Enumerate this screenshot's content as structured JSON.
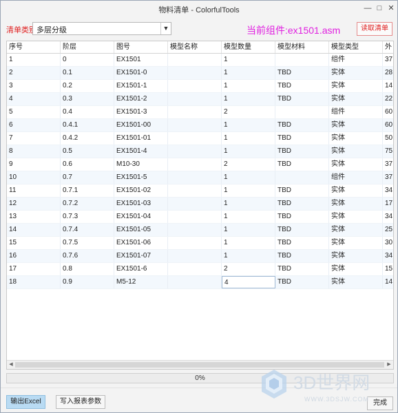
{
  "window": {
    "title": "物料清单 - ColorfulTools"
  },
  "toolbar": {
    "category_label": "清单类别",
    "category_value": "多层分级",
    "current_component": "当前组件:ex1501.asm",
    "read_button": "读取清单"
  },
  "table": {
    "columns": [
      "序号",
      "阶层",
      "图号",
      "模型名称",
      "模型数量",
      "模型材料",
      "模型类型",
      "外"
    ],
    "rows": [
      [
        "1",
        "0",
        "EX1501",
        "",
        "1",
        "",
        "组件",
        "37"
      ],
      [
        "2",
        "0.1",
        "EX1501-0",
        "",
        "1",
        "TBD",
        "实体",
        "28"
      ],
      [
        "3",
        "0.2",
        "EX1501-1",
        "",
        "1",
        "TBD",
        "实体",
        "14"
      ],
      [
        "4",
        "0.3",
        "EX1501-2",
        "",
        "1",
        "TBD",
        "实体",
        "22"
      ],
      [
        "5",
        "0.4",
        "EX1501-3",
        "",
        "2",
        "",
        "组件",
        "60"
      ],
      [
        "6",
        "0.4.1",
        "EX1501-00",
        "",
        "1",
        "TBD",
        "实体",
        "60"
      ],
      [
        "7",
        "0.4.2",
        "EX1501-01",
        "",
        "1",
        "TBD",
        "实体",
        "50"
      ],
      [
        "8",
        "0.5",
        "EX1501-4",
        "",
        "1",
        "TBD",
        "实体",
        "75"
      ],
      [
        "9",
        "0.6",
        "M10-30",
        "",
        "2",
        "TBD",
        "实体",
        "37"
      ],
      [
        "10",
        "0.7",
        "EX1501-5",
        "",
        "1",
        "",
        "组件",
        "37"
      ],
      [
        "11",
        "0.7.1",
        "EX1501-02",
        "",
        "1",
        "TBD",
        "实体",
        "34"
      ],
      [
        "12",
        "0.7.2",
        "EX1501-03",
        "",
        "1",
        "TBD",
        "实体",
        "17"
      ],
      [
        "13",
        "0.7.3",
        "EX1501-04",
        "",
        "1",
        "TBD",
        "实体",
        "34"
      ],
      [
        "14",
        "0.7.4",
        "EX1501-05",
        "",
        "1",
        "TBD",
        "实体",
        "25"
      ],
      [
        "15",
        "0.7.5",
        "EX1501-06",
        "",
        "1",
        "TBD",
        "实体",
        "30"
      ],
      [
        "16",
        "0.7.6",
        "EX1501-07",
        "",
        "1",
        "TBD",
        "实体",
        "34"
      ],
      [
        "17",
        "0.8",
        "EX1501-6",
        "",
        "2",
        "TBD",
        "实体",
        "15"
      ],
      [
        "18",
        "0.9",
        "M5-12",
        "",
        "4",
        "TBD",
        "实体",
        "14"
      ]
    ]
  },
  "progress": {
    "text": "0%",
    "fraction": 0
  },
  "buttons": {
    "export_excel": "输出Excel",
    "write_params": "写入报表参数",
    "done": "完成"
  },
  "watermark": {
    "brand": "3D世界网",
    "url": "WWW.3DSJW.COM"
  },
  "colors": {
    "category_label": "#e02020",
    "current_component": "#e020e0",
    "export_button": "#b9dbf3",
    "row_alt": "#f3f8fd"
  }
}
